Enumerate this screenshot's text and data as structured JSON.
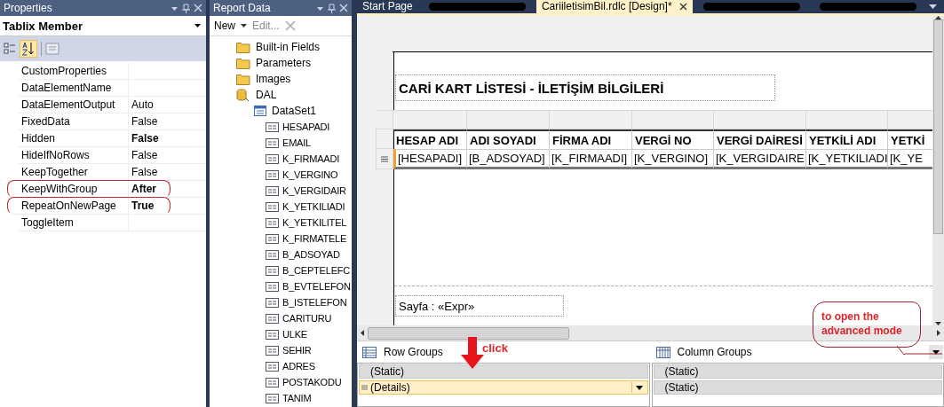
{
  "properties": {
    "title": "Properties",
    "object": "Tablix Member",
    "rows": [
      {
        "name": "CustomProperties",
        "highlighted": false
      },
      {
        "name": "DataElementName",
        "highlighted": false
      },
      {
        "name": "DataElementOutput",
        "value": "Auto",
        "bold": false,
        "highlighted": false
      },
      {
        "name": "FixedData",
        "value": "False",
        "bold": false,
        "highlighted": false
      },
      {
        "name": "Hidden",
        "value": "False",
        "bold": true,
        "highlighted": false
      },
      {
        "name": "HideIfNoRows",
        "value": "False",
        "bold": false,
        "highlighted": false
      },
      {
        "name": "KeepTogether",
        "value": "False",
        "bold": false,
        "highlighted": false
      },
      {
        "name": "KeepWithGroup",
        "value": "After",
        "bold": true,
        "highlighted": true
      },
      {
        "name": "RepeatOnNewPage",
        "value": "True",
        "bold": true,
        "highlighted": true
      },
      {
        "name": "ToggleItem",
        "highlighted": false
      }
    ]
  },
  "report_data": {
    "title": "Report Data",
    "new_label": "New",
    "edit_label": "Edit...",
    "tree": [
      {
        "label": "Built-in Fields",
        "kind": "folder"
      },
      {
        "label": "Parameters",
        "kind": "folder"
      },
      {
        "label": "Images",
        "kind": "folder"
      },
      {
        "label": "DAL",
        "kind": "datasource",
        "children": [
          {
            "label": "DataSet1",
            "kind": "dataset",
            "children": [
              {
                "label": "HESAPADI",
                "kind": "field"
              },
              {
                "label": "EMAIL",
                "kind": "field"
              },
              {
                "label": "K_FIRMAADI",
                "kind": "field"
              },
              {
                "label": "K_VERGINO",
                "kind": "field"
              },
              {
                "label": "K_VERGIDAIR",
                "kind": "field"
              },
              {
                "label": "K_YETKILIADI",
                "kind": "field"
              },
              {
                "label": "K_YETKILITEL",
                "kind": "field"
              },
              {
                "label": "K_FIRMATELE",
                "kind": "field"
              },
              {
                "label": "B_ADSOYAD",
                "kind": "field"
              },
              {
                "label": "B_CEPTELEFC",
                "kind": "field"
              },
              {
                "label": "B_EVTELEFON",
                "kind": "field"
              },
              {
                "label": "B_ISTELEFON",
                "kind": "field"
              },
              {
                "label": "CARITURU",
                "kind": "field"
              },
              {
                "label": "ULKE",
                "kind": "field"
              },
              {
                "label": "SEHIR",
                "kind": "field"
              },
              {
                "label": "ADRES",
                "kind": "field"
              },
              {
                "label": "POSTAKODU",
                "kind": "field"
              },
              {
                "label": "TANIM",
                "kind": "field"
              }
            ]
          }
        ]
      }
    ]
  },
  "designer": {
    "tabs": [
      {
        "kind": "normal",
        "label": "Start Page",
        "selected": false
      },
      {
        "kind": "redacted",
        "selected": false
      },
      {
        "kind": "normal",
        "label": "CariiletisimBil.rdlc [Design]*",
        "selected": true
      },
      {
        "kind": "redacted",
        "selected": false
      },
      {
        "kind": "redacted",
        "selected": false
      }
    ],
    "report": {
      "title": "CARİ KART LİSTESİ - İLETİŞİM BİLGİLERİ",
      "columns": [
        "HESAP ADI",
        "ADI SOYADI",
        "FİRMA ADI",
        "VERGİ NO",
        "VERGİ DAİRESİ",
        "YETKİLİ ADI",
        "YETKİ"
      ],
      "cells": [
        "[HESAPADI]",
        "[B_ADSOYAD]",
        "[K_FIRMAADI]",
        "[K_VERGINO]",
        "[K_VERGIDAIRE",
        "[K_YETKILIADI",
        "[K_YE"
      ],
      "footer": "Sayfa : «Expr»"
    },
    "groups": {
      "row_title": "Row Groups",
      "column_title": "Column Groups",
      "row_groups": [
        {
          "label": "(Static)",
          "selected": false
        },
        {
          "label": "(Details)",
          "selected": true
        }
      ],
      "column_groups": [
        {
          "label": "(Static)"
        },
        {
          "label": "(Static)"
        }
      ]
    }
  },
  "annotations": [
    {
      "kind": "arrow",
      "text": "click"
    },
    {
      "kind": "callout",
      "text": "to open the advanced mode"
    }
  ]
}
